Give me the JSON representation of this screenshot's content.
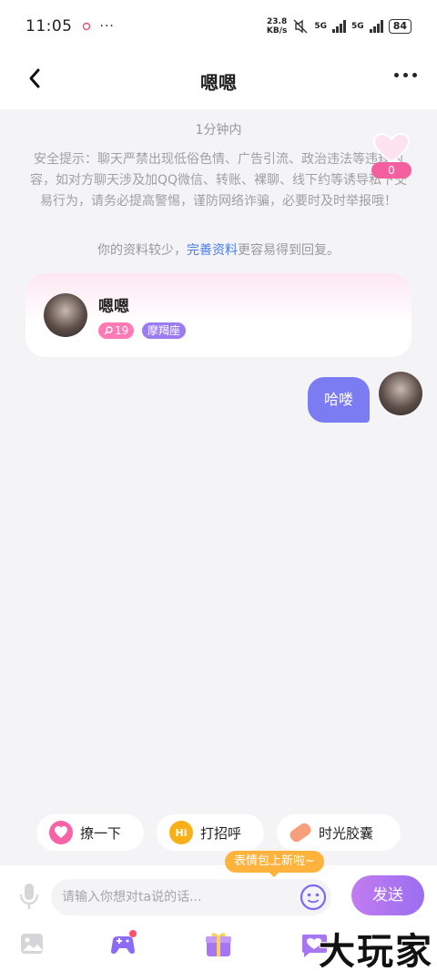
{
  "status_bar": {
    "time": "11:05",
    "net_speed_value": "23.8",
    "net_speed_unit": "KB/s",
    "sim1": "5G",
    "sim2": "5G",
    "battery": "84"
  },
  "header": {
    "title": "嗯嗯"
  },
  "chat": {
    "timestamp": "1分钟内",
    "safety_notice": "安全提示：聊天严禁出现低俗色情、广告引流、政治违法等违规内容，如对方聊天涉及加QQ微信、转账、裸聊、线下约等诱导私下交易行为，请务必提高警惕，谨防网络诈骗，必要时及时举报哦！",
    "profile_tip_before": "你的资料较少，",
    "profile_tip_link": "完善资料",
    "profile_tip_after": "更容易得到回复。",
    "heart_count": "0",
    "profile_card": {
      "name": "嗯嗯",
      "age": "19",
      "zodiac": "摩羯座"
    },
    "messages": [
      {
        "text": "哈喽"
      }
    ]
  },
  "quick_actions": [
    {
      "label": "撩一下",
      "icon": "flirt-icon"
    },
    {
      "label": "打招呼",
      "icon": "hi-icon"
    },
    {
      "label": "时光胶囊",
      "icon": "capsule-icon"
    }
  ],
  "new_emoji_tip": "表情包上新啦~",
  "input": {
    "placeholder": "请输入你想对ta说的话...",
    "send_label": "发送"
  },
  "watermark": "大玩家"
}
